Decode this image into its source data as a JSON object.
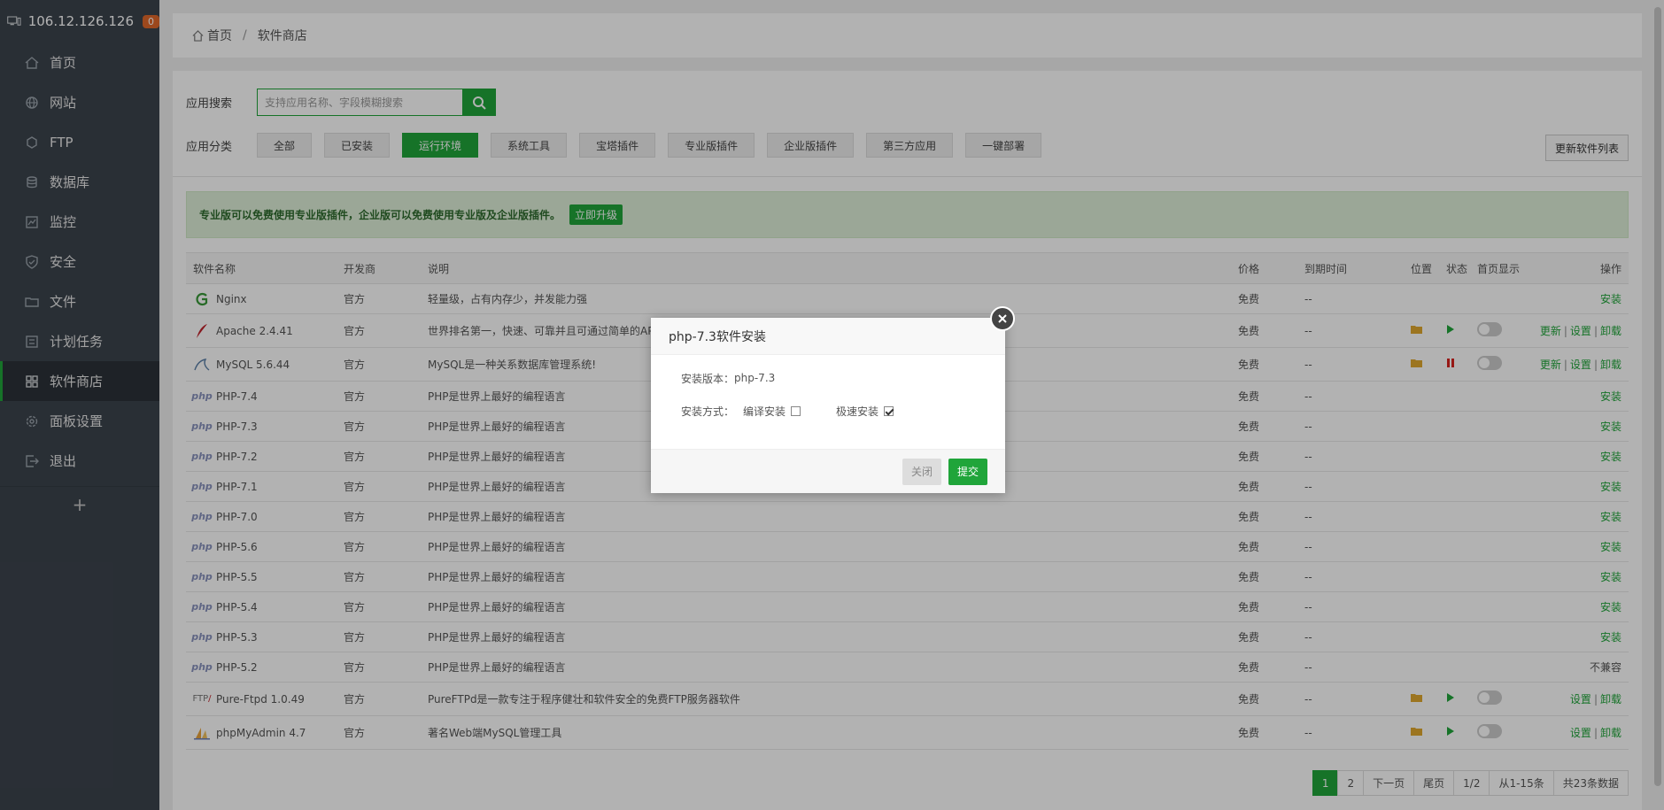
{
  "header": {
    "ip": "106.12.126.126",
    "badge": "0"
  },
  "sidebar": {
    "items": [
      {
        "label": "首页",
        "icon": "home-icon"
      },
      {
        "label": "网站",
        "icon": "globe-icon"
      },
      {
        "label": "FTP",
        "icon": "ftp-icon"
      },
      {
        "label": "数据库",
        "icon": "database-icon"
      },
      {
        "label": "监控",
        "icon": "monitor-icon"
      },
      {
        "label": "安全",
        "icon": "shield-icon"
      },
      {
        "label": "文件",
        "icon": "folder-icon"
      },
      {
        "label": "计划任务",
        "icon": "clock-icon"
      },
      {
        "label": "软件商店",
        "icon": "grid-icon",
        "active": true
      },
      {
        "label": "面板设置",
        "icon": "gear-icon"
      },
      {
        "label": "退出",
        "icon": "logout-icon"
      }
    ],
    "add": "+"
  },
  "breadcrumb": {
    "home": "首页",
    "sep": "/",
    "current": "软件商店"
  },
  "search": {
    "label": "应用搜索",
    "placeholder": "支持应用名称、字段模糊搜索"
  },
  "categories": {
    "label": "应用分类",
    "items": [
      "全部",
      "已安装",
      "运行环境",
      "系统工具",
      "宝塔插件",
      "专业版插件",
      "企业版插件",
      "第三方应用",
      "一键部署"
    ],
    "active": "运行环境"
  },
  "update_button": "更新软件列表",
  "alert": {
    "text": "专业版可以免费使用专业版插件，企业版可以免费使用专业版及企业版插件。",
    "button": "立即升级"
  },
  "table": {
    "headers": [
      "软件名称",
      "开发商",
      "说明",
      "价格",
      "到期时间",
      "位置",
      "状态",
      "首页显示",
      "操作"
    ],
    "rows": [
      {
        "name": "Nginx",
        "logo": "nginx",
        "dev": "官方",
        "desc": "轻量级，占有内存少，并发能力强",
        "price": "免费",
        "expire": "--",
        "ops": [
          "安装"
        ]
      },
      {
        "name": "Apache 2.4.41",
        "logo": "apache",
        "dev": "官方",
        "desc": "世界排名第一，快速、可靠并且可通过简单的API扩充",
        "price": "免费",
        "expire": "--",
        "folder": true,
        "status": "play",
        "toggle": true,
        "ops": [
          "更新",
          "设置",
          "卸载"
        ]
      },
      {
        "name": "MySQL 5.6.44",
        "logo": "mysql",
        "dev": "官方",
        "desc": "MySQL是一种关系数据库管理系统!",
        "price": "免费",
        "expire": "--",
        "folder": true,
        "status": "pause",
        "toggle": true,
        "ops": [
          "更新",
          "设置",
          "卸载"
        ]
      },
      {
        "name": "PHP-7.4",
        "logo": "php",
        "dev": "官方",
        "desc": "PHP是世界上最好的编程语言",
        "price": "免费",
        "expire": "--",
        "ops": [
          "安装"
        ]
      },
      {
        "name": "PHP-7.3",
        "logo": "php",
        "dev": "官方",
        "desc": "PHP是世界上最好的编程语言",
        "price": "免费",
        "expire": "--",
        "ops": [
          "安装"
        ]
      },
      {
        "name": "PHP-7.2",
        "logo": "php",
        "dev": "官方",
        "desc": "PHP是世界上最好的编程语言",
        "price": "免费",
        "expire": "--",
        "ops": [
          "安装"
        ]
      },
      {
        "name": "PHP-7.1",
        "logo": "php",
        "dev": "官方",
        "desc": "PHP是世界上最好的编程语言",
        "price": "免费",
        "expire": "--",
        "ops": [
          "安装"
        ]
      },
      {
        "name": "PHP-7.0",
        "logo": "php",
        "dev": "官方",
        "desc": "PHP是世界上最好的编程语言",
        "price": "免费",
        "expire": "--",
        "ops": [
          "安装"
        ]
      },
      {
        "name": "PHP-5.6",
        "logo": "php",
        "dev": "官方",
        "desc": "PHP是世界上最好的编程语言",
        "price": "免费",
        "expire": "--",
        "ops": [
          "安装"
        ]
      },
      {
        "name": "PHP-5.5",
        "logo": "php",
        "dev": "官方",
        "desc": "PHP是世界上最好的编程语言",
        "price": "免费",
        "expire": "--",
        "ops": [
          "安装"
        ]
      },
      {
        "name": "PHP-5.4",
        "logo": "php",
        "dev": "官方",
        "desc": "PHP是世界上最好的编程语言",
        "price": "免费",
        "expire": "--",
        "ops": [
          "安装"
        ]
      },
      {
        "name": "PHP-5.3",
        "logo": "php",
        "dev": "官方",
        "desc": "PHP是世界上最好的编程语言",
        "price": "免费",
        "expire": "--",
        "ops": [
          "安装"
        ]
      },
      {
        "name": "PHP-5.2",
        "logo": "php",
        "dev": "官方",
        "desc": "PHP是世界上最好的编程语言",
        "price": "免费",
        "expire": "--",
        "ops_text": "不兼容"
      },
      {
        "name": "Pure-Ftpd 1.0.49",
        "logo": "ftp",
        "dev": "官方",
        "desc": "PureFTPd是一款专注于程序健壮和软件安全的免费FTP服务器软件",
        "price": "免费",
        "expire": "--",
        "folder": true,
        "status": "play",
        "toggle": true,
        "ops": [
          "设置",
          "卸载"
        ]
      },
      {
        "name": "phpMyAdmin 4.7",
        "logo": "pma",
        "dev": "官方",
        "desc": "著名Web端MySQL管理工具",
        "price": "免费",
        "expire": "--",
        "folder": true,
        "status": "play",
        "toggle": true,
        "ops": [
          "设置",
          "卸载"
        ]
      }
    ]
  },
  "pagination": {
    "pages": [
      "1",
      "2"
    ],
    "next": "下一页",
    "last": "尾页",
    "page_info": "1/2",
    "range": "从1-15条",
    "total": "共23条数据"
  },
  "dialog": {
    "title": "php-7.3软件安装",
    "version_label": "安装版本：",
    "version": "php-7.3",
    "method_label": "安装方式：",
    "compile": "编译安装",
    "fast": "极速安装",
    "compile_checked": false,
    "fast_checked": true,
    "close": "关闭",
    "submit": "提交"
  },
  "colors": {
    "accent": "#20a53a",
    "sidebar": "#3c444d"
  }
}
